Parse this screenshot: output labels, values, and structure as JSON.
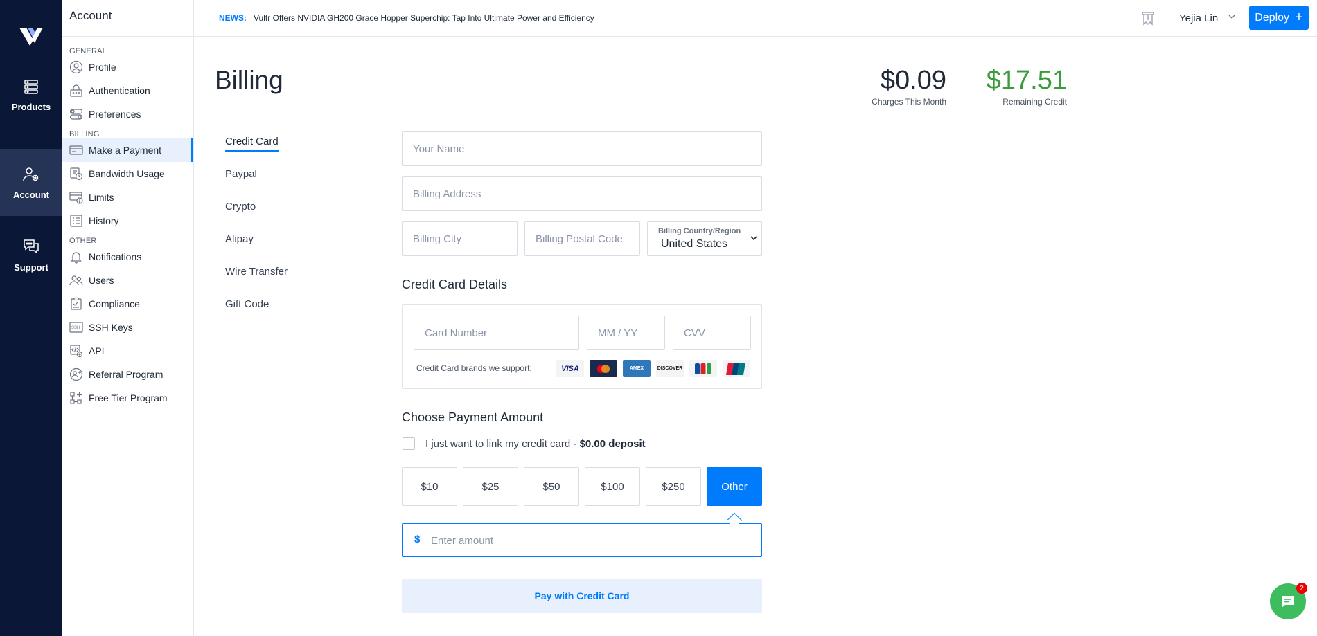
{
  "rail": {
    "items": [
      {
        "label": "Products",
        "icon": "server-stack-icon"
      },
      {
        "label": "Account",
        "icon": "user-gear-icon",
        "active": true
      },
      {
        "label": "Support",
        "icon": "chat-bubbles-icon"
      }
    ]
  },
  "sidebar": {
    "title": "Account",
    "sections": {
      "general": "GENERAL",
      "billing": "BILLING",
      "other": "OTHER"
    },
    "general_items": [
      "Profile",
      "Authentication",
      "Preferences"
    ],
    "billing_items": [
      "Make a Payment",
      "Bandwidth Usage",
      "Limits",
      "History"
    ],
    "other_items": [
      "Notifications",
      "Users",
      "Compliance",
      "SSH Keys",
      "API",
      "Referral Program",
      "Free Tier Program"
    ]
  },
  "topbar": {
    "news_label": "NEWS:",
    "news_text": "Vultr Offers NVIDIA GH200 Grace Hopper Superchip: Tap Into Ultimate Power and Efficiency",
    "user_name": "Yejia Lin",
    "deploy_label": "Deploy",
    "deploy_symbol": "+"
  },
  "page": {
    "title": "Billing",
    "charges_value": "$0.09",
    "charges_label": "Charges This Month",
    "credit_value": "$17.51",
    "credit_label": "Remaining Credit",
    "credit_color": "#3a9b3a"
  },
  "methods": [
    "Credit Card",
    "Paypal",
    "Crypto",
    "Alipay",
    "Wire Transfer",
    "Gift Code"
  ],
  "form": {
    "name_placeholder": "Your Name",
    "address_placeholder": "Billing Address",
    "city_placeholder": "Billing City",
    "postal_placeholder": "Billing Postal Code",
    "country_caption": "Billing Country/Region",
    "country_value": "United States",
    "cc_heading": "Credit Card Details",
    "card_number_placeholder": "Card Number",
    "expiry_placeholder": "MM / YY",
    "cvv_placeholder": "CVV",
    "brands_label": "Credit Card brands we support:",
    "brands": [
      "VISA",
      "MC",
      "AMEX",
      "DISCOVER",
      "JCB",
      "UnionPay"
    ],
    "amount_heading": "Choose Payment Amount",
    "link_only_text": "I just want to link my credit card - ",
    "link_only_bold": "$0.00 deposit",
    "amounts": [
      "$10",
      "$25",
      "$50",
      "$100",
      "$250",
      "Other"
    ],
    "amount_currency": "$",
    "amount_placeholder": "Enter amount",
    "pay_label": "Pay with Credit Card"
  },
  "chat": {
    "badge": "2"
  },
  "colors": {
    "accent": "#007bfc",
    "rail": "#0b1736",
    "success": "#3a9b3a"
  }
}
